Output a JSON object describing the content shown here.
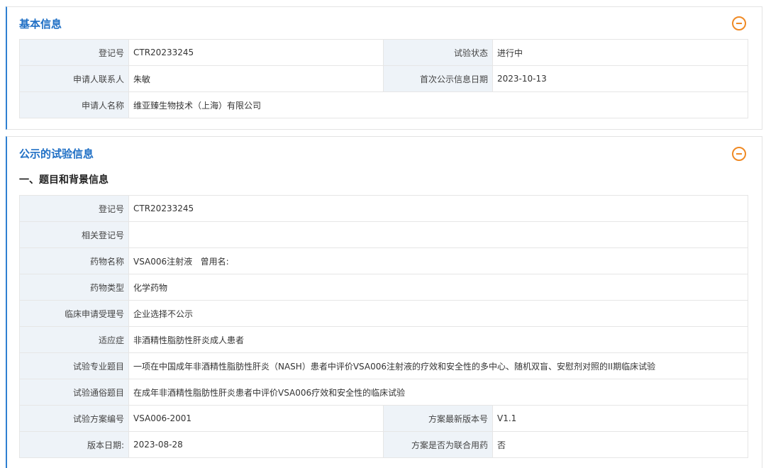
{
  "basic": {
    "title": "基本信息",
    "rows": [
      {
        "l1": "登记号",
        "v1": "CTR20233245",
        "l2": "试验状态",
        "v2": "进行中"
      },
      {
        "l1": "申请人联系人",
        "v1": "朱敏",
        "l2": "首次公示信息日期",
        "v2": "2023-10-13"
      },
      {
        "l1": "申请人名称",
        "v1": "维亚臻生物技术（上海）有限公司"
      }
    ]
  },
  "trial": {
    "title": "公示的试验信息",
    "section": "一、题目和背景信息",
    "rows": [
      {
        "l1": "登记号",
        "v1": "CTR20233245"
      },
      {
        "l1": "相关登记号",
        "v1": ""
      },
      {
        "l1": "药物名称",
        "v1": "VSA006注射液   曾用名:"
      },
      {
        "l1": "药物类型",
        "v1": "化学药物"
      },
      {
        "l1": "临床申请受理号",
        "v1": "企业选择不公示"
      },
      {
        "l1": "适应症",
        "v1": "非酒精性脂肪性肝炎成人患者"
      },
      {
        "l1": "试验专业题目",
        "v1": "一项在中国成年非酒精性脂肪性肝炎（NASH）患者中评价VSA006注射液的疗效和安全性的多中心、随机双盲、安慰剂对照的II期临床试验"
      },
      {
        "l1": "试验通俗题目",
        "v1": "在成年非酒精性脂肪性肝炎患者中评价VSA006疗效和安全性的临床试验"
      },
      {
        "l1": "试验方案编号",
        "v1": "VSA006-2001",
        "l2": "方案最新版本号",
        "v2": "V1.1"
      },
      {
        "l1": "版本日期:",
        "v1": "2023-08-28",
        "l2": "方案是否为联合用药",
        "v2": "否"
      }
    ]
  },
  "colors": {
    "accent": "#1f6fc5",
    "collapse": "#f08a24",
    "label_bg": "#eef3f8"
  }
}
